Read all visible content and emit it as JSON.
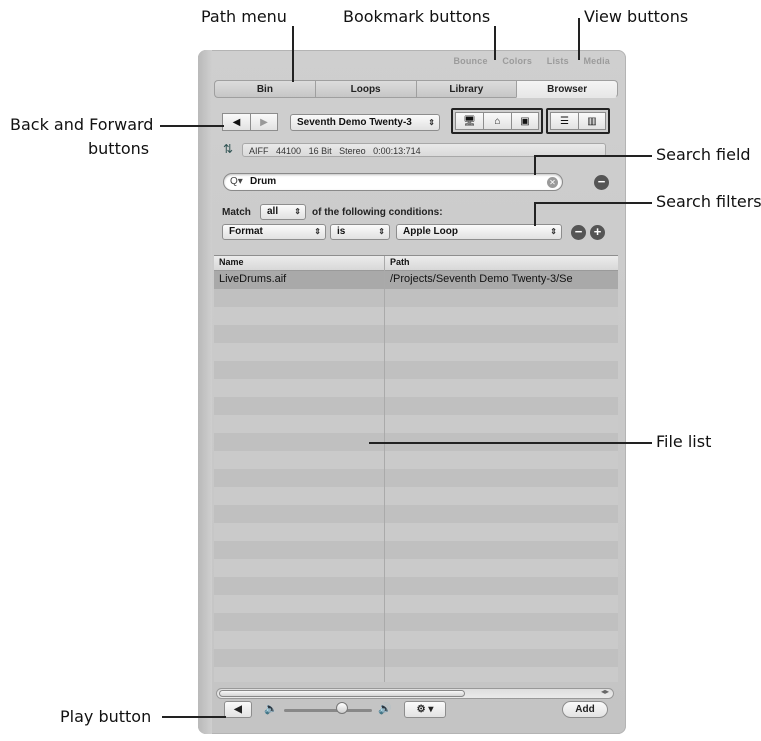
{
  "callouts": {
    "path_menu": "Path menu",
    "bookmark_buttons": "Bookmark buttons",
    "view_buttons": "View buttons",
    "back_forward_line1": "Back and Forward",
    "back_forward_line2": "buttons",
    "search_field": "Search field",
    "search_filters": "Search filters",
    "file_list": "File list",
    "play_button": "Play button"
  },
  "upper_tabs": [
    "Bounce",
    "Colors",
    "Lists",
    "Media"
  ],
  "tabs": [
    {
      "label": "Bin",
      "active": false
    },
    {
      "label": "Loops",
      "active": false
    },
    {
      "label": "Library",
      "active": false
    },
    {
      "label": "Browser",
      "active": true
    }
  ],
  "path_menu": {
    "value": "Seventh Demo Twenty-3"
  },
  "info_bar": {
    "format": "AIFF",
    "rate": "44100",
    "bits": "16 Bit",
    "channels": "Stereo",
    "duration": "0:00:13:714"
  },
  "search": {
    "value": "Drum"
  },
  "filter": {
    "match_label": "Match",
    "match_value": "all",
    "conditions_label": "of the following conditions:",
    "field": "Format",
    "operator": "is",
    "value": "Apple Loop"
  },
  "list": {
    "columns": [
      "Name",
      "Path"
    ],
    "rows": [
      {
        "name": "LiveDrums.aif",
        "path": "/Projects/Seventh Demo Twenty-3/Se"
      }
    ]
  },
  "footer": {
    "add_label": "Add"
  },
  "icons": [
    "back-icon",
    "forward-icon",
    "computer-icon",
    "home-icon",
    "briefcase-icon",
    "list-view-icon",
    "column-view-icon",
    "magnifier-icon",
    "clear-icon",
    "remove-icon",
    "add-icon",
    "play-icon",
    "speaker-low-icon",
    "speaker-high-icon",
    "gear-icon"
  ]
}
